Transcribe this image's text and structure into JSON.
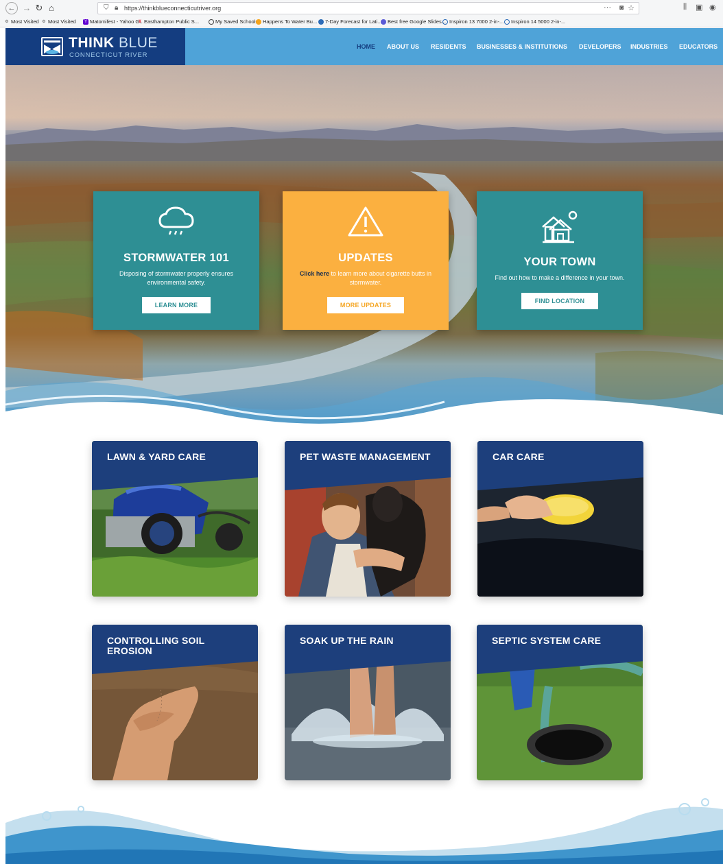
{
  "browser": {
    "url": "https://thinkblueconnecticutriver.org",
    "bookmarks": [
      "Most Visited",
      "Most Visited",
      "Matomifest - Yahoo G...",
      "Easthampton Public S...",
      "My Saved Schools",
      "Happens To Water Bu...",
      "7-Day Forecast for Lati...",
      "Best free Google Slides...",
      "Inspiron 13 7000 2-in-...",
      "Inspiron 14 5000 2-in-..."
    ]
  },
  "header": {
    "logo_think": "THINK",
    "logo_blue": "BLUE",
    "logo_sub": "CONNECTICUT RIVER",
    "nav": [
      "HOME",
      "ABOUT US",
      "RESIDENTS",
      "BUSINESSES & INSTITUTIONS",
      "DEVELOPERS",
      "INDUSTRIES",
      "EDUCATORS"
    ]
  },
  "hero_cards": {
    "stormwater": {
      "title": "STORMWATER 101",
      "desc": "Disposing of stormwater properly ensures environmental safety.",
      "button": "LEARN MORE"
    },
    "updates": {
      "title": "UPDATES",
      "link": "Click here",
      "desc": "to learn more about cigarette butts in stormwater.",
      "button": "MORE UPDATES"
    },
    "town": {
      "title": "YOUR TOWN",
      "desc": "Find out how to make a difference in your town.",
      "button": "FIND LOCATION"
    }
  },
  "tiles": {
    "lawn": "LAWN & YARD CARE",
    "pet": "PET WASTE MANAGEMENT",
    "car": "CAR CARE",
    "soil": "CONTROLLING SOIL EROSION",
    "rain": "SOAK UP THE RAIN",
    "septic": "SEPTIC SYSTEM CARE"
  },
  "colors": {
    "header_blue": "#4fa3d8",
    "logo_navy": "#143d80",
    "teal": "#2e8f94",
    "orange": "#fbb040",
    "tile_band": "#1d3f7c"
  }
}
